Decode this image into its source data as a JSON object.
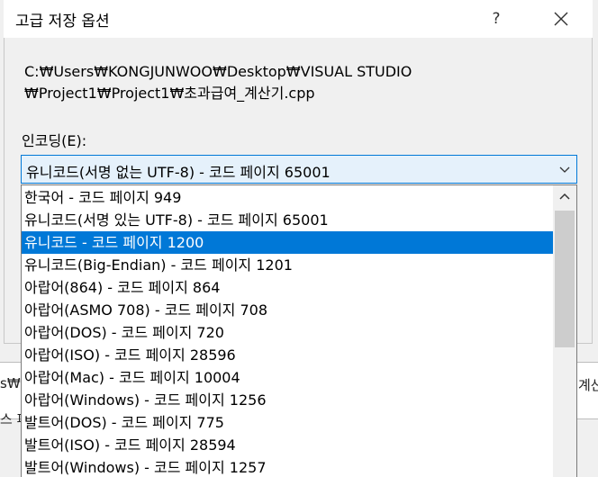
{
  "dialog": {
    "title": "고급 저장 옵션",
    "help": "?",
    "path_line1": "C:₩Users₩KONGJUNWOO₩Desktop₩VISUAL STUDIO",
    "path_line2": "₩Project1₩Project1₩초과급여_계산기.cpp",
    "encoding_label": "인코딩(E):",
    "encoding_selected": "유니코드(서명 없는 UTF-8) - 코드 페이지 65001",
    "options": [
      "한국어 - 코드 페이지 949",
      "유니코드(서명 있는 UTF-8) - 코드 페이지 65001",
      "유니코드 - 코드 페이지 1200",
      "유니코드(Big-Endian) - 코드 페이지 1201",
      "아랍어(864) - 코드 페이지 864",
      "아랍어(ASMO 708) - 코드 페이지 708",
      "아랍어(DOS) - 코드 페이지 720",
      "아랍어(ISO) - 코드 페이지 28596",
      "아랍어(Mac) - 코드 페이지 10004",
      "아랍어(Windows) - 코드 페이지 1256",
      "발트어(DOS) - 코드 페이지 775",
      "발트어(ISO) - 코드 페이지 28594",
      "발트어(Windows) - 코드 페이지 1257"
    ],
    "highlighted_index": 2
  },
  "background": {
    "left_frag1": "s₩",
    "left_frag2": "스 파",
    "right_frag": "계산"
  },
  "colors": {
    "accent": "#0078d7",
    "combo_bg": "#e5f1fb"
  },
  "icons": {
    "close": "close-icon",
    "chevron": "chevron-down-icon",
    "scroll_up": "chevron-up-icon"
  }
}
